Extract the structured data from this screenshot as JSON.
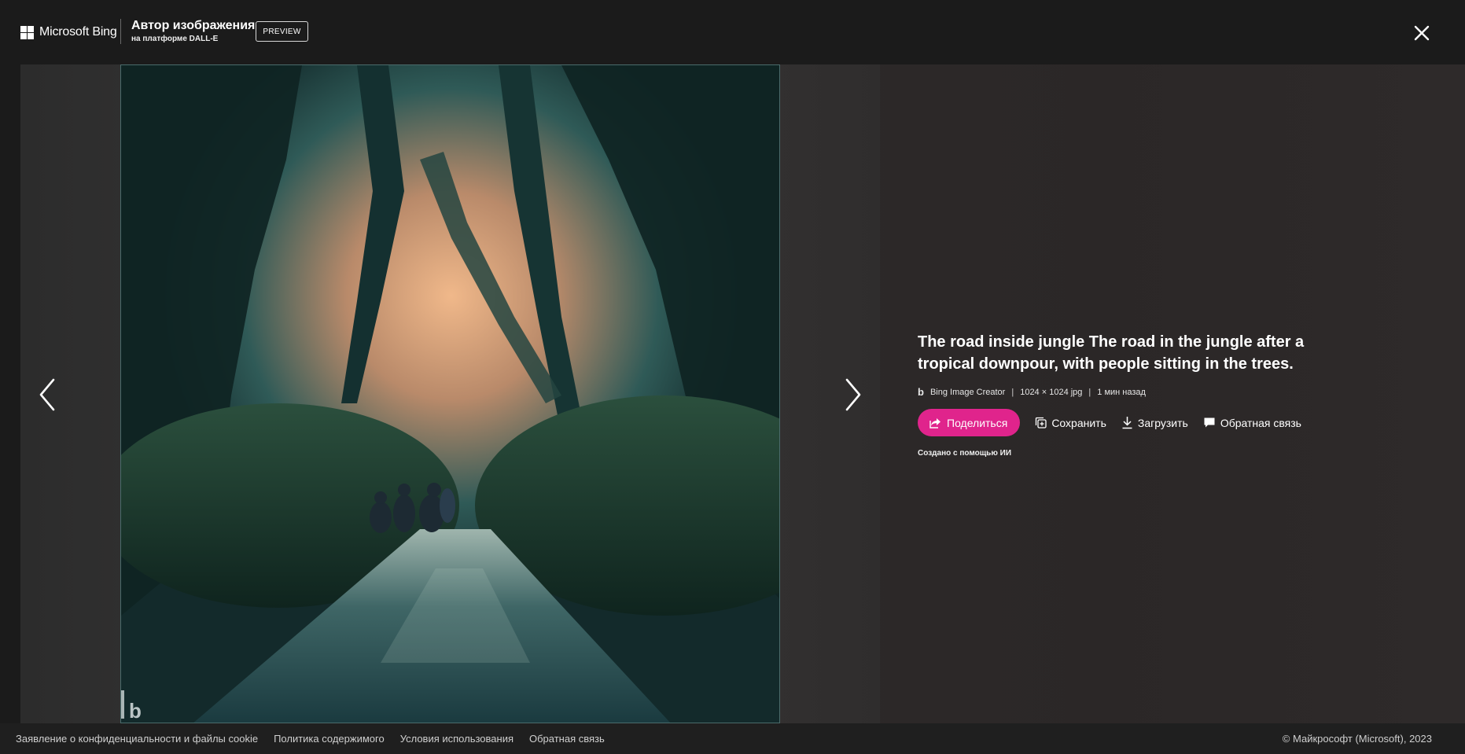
{
  "header": {
    "brand": "Microsoft Bing",
    "product_title": "Автор изображения",
    "product_subtitle": "на платформе DALL-E",
    "badge": "PREVIEW",
    "close_icon": "close-icon"
  },
  "viewer": {
    "prev_icon": "chevron-left-icon",
    "next_icon": "chevron-right-icon",
    "image_description_icon": "generated-image"
  },
  "details": {
    "title": "The road inside jungle The road in the jungle after a tropical downpour, with people sitting in the trees.",
    "creator_icon": "b",
    "creator": "Bing Image Creator",
    "separator": "|",
    "dimensions": "1024 × 1024 jpg",
    "time": "1 мин назад",
    "actions": {
      "share": "Поделиться",
      "save": "Сохранить",
      "download": "Загрузить",
      "feedback": "Обратная связь"
    },
    "ai_note": "Создано с помощью ИИ"
  },
  "footer": {
    "links": [
      "Заявление о конфиденциальности и файлы cookie",
      "Политика содержимого",
      "Условия использования",
      "Обратная связь"
    ],
    "copyright": "© Майкрософт (Microsoft), 2023"
  },
  "colors": {
    "accent": "#e0248c",
    "background": "#1b1b1b"
  }
}
